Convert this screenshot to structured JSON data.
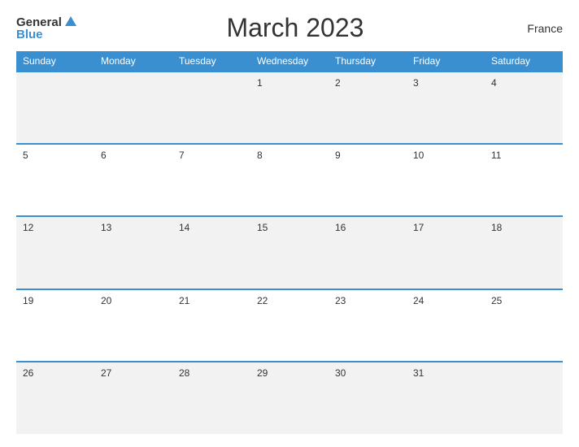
{
  "header": {
    "logo": {
      "general": "General",
      "blue": "Blue",
      "triangle": true
    },
    "title": "March 2023",
    "country": "France"
  },
  "calendar": {
    "days_of_week": [
      "Sunday",
      "Monday",
      "Tuesday",
      "Wednesday",
      "Thursday",
      "Friday",
      "Saturday"
    ],
    "weeks": [
      [
        "",
        "",
        "",
        "1",
        "2",
        "3",
        "4"
      ],
      [
        "5",
        "6",
        "7",
        "8",
        "9",
        "10",
        "11"
      ],
      [
        "12",
        "13",
        "14",
        "15",
        "16",
        "17",
        "18"
      ],
      [
        "19",
        "20",
        "21",
        "22",
        "23",
        "24",
        "25"
      ],
      [
        "26",
        "27",
        "28",
        "29",
        "30",
        "31",
        ""
      ]
    ]
  }
}
